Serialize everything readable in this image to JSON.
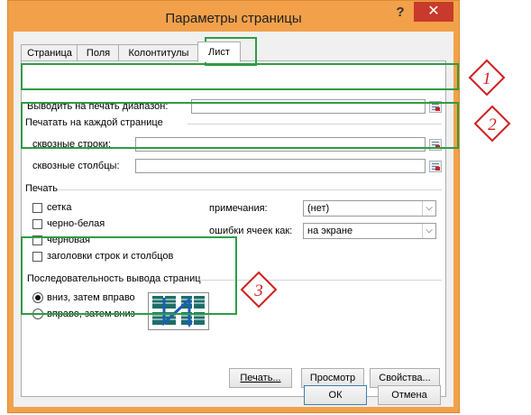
{
  "dialog": {
    "title": "Параметры страницы",
    "help_label": "?",
    "close_label": "✕"
  },
  "tabs": [
    {
      "label": "Страница",
      "active": false
    },
    {
      "label": "Поля",
      "active": false
    },
    {
      "label": "Колонтитулы",
      "active": false
    },
    {
      "label": "Лист",
      "active": true
    }
  ],
  "print_area": {
    "label": "Выводить на печать диапазон:",
    "value": ""
  },
  "print_titles": {
    "heading": "Печатать на каждой странице",
    "rows_label": "сквозные строки:",
    "rows_value": "",
    "cols_label": "сквозные столбцы:",
    "cols_value": ""
  },
  "print": {
    "heading": "Печать",
    "options": [
      {
        "label": "сетка",
        "checked": false
      },
      {
        "label": "черно-белая",
        "checked": false
      },
      {
        "label": "черновая",
        "checked": false
      },
      {
        "label": "заголовки строк и столбцов",
        "checked": false
      }
    ],
    "comments_label": "примечания:",
    "comments_value": "(нет)",
    "errors_label": "ошибки ячеек как:",
    "errors_value": "на экране"
  },
  "page_order": {
    "heading": "Последовательность вывода страниц",
    "options": [
      {
        "label": "вниз, затем вправо",
        "selected": true
      },
      {
        "label": "вправо, затем вниз",
        "selected": false
      }
    ]
  },
  "buttons": {
    "print": "Печать...",
    "preview": "Просмотр",
    "properties": "Свойства...",
    "ok": "ОК",
    "cancel": "Отмена"
  },
  "annotations": [
    "1",
    "2",
    "3"
  ],
  "colors": {
    "frame": "#f2a14a",
    "close": "#c83a2b",
    "highlight": "#2e9d43",
    "marker": "#d21e1e"
  }
}
